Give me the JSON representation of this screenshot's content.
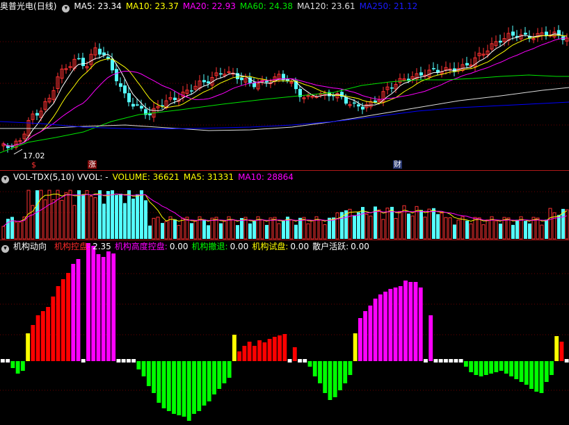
{
  "colors": {
    "up": "#ff3232",
    "down": "#54ffff",
    "ma5": "#ffffff",
    "ma10": "#ffff00",
    "ma20": "#ff00ff",
    "ma60": "#00e600",
    "ma120": "#dddddd",
    "ma250": "#0000ff",
    "grid": "#6b0000",
    "green": "#00ff00",
    "red": "#ff0000",
    "magenta": "#ff00ff",
    "yellow": "#ffff00",
    "white": "#ffffff"
  },
  "price": {
    "stock_name": "奥普光电",
    "period": "(日线)",
    "indicators": [
      {
        "label": "MA5: 23.34",
        "color": "#ffffff"
      },
      {
        "label": "MA10: 23.37",
        "color": "#ffff00"
      },
      {
        "label": "MA20: 22.93",
        "color": "#ff00ff"
      },
      {
        "label": "MA60: 24.38",
        "color": "#00e600"
      },
      {
        "label": "MA120: 23.61",
        "color": "#dddddd"
      },
      {
        "label": "MA250: 21.12",
        "color": "#1a1aff"
      }
    ],
    "low_label": "17.02",
    "event_marks": [
      "$",
      "涨",
      "财"
    ]
  },
  "volume": {
    "name": "VOL-TDX(5,10)",
    "indicators": [
      {
        "label": "VVOL: -",
        "color": "#ffffff"
      },
      {
        "label": "VOLUME: 36621",
        "color": "#ffff00"
      },
      {
        "label": "MA5: 31331",
        "color": "#ffff00"
      },
      {
        "label": "MA10: 28864",
        "color": "#ff00ff"
      }
    ]
  },
  "inst": {
    "name": "机构动向",
    "indicators": [
      {
        "label": "机构控盘:",
        "value": "2.35",
        "color": "#ff2a2a"
      },
      {
        "label": "机构高度控盘:",
        "value": "0.00",
        "color": "#ff00ff"
      },
      {
        "label": "机构撤退:",
        "value": "0.00",
        "color": "#00ff00"
      },
      {
        "label": "机构试盘:",
        "value": "0.00",
        "color": "#ffff00"
      },
      {
        "label": "散户活跃:",
        "value": "0.00",
        "color": "#ffffff"
      }
    ]
  }
}
